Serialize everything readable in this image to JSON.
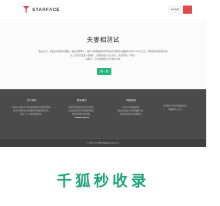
{
  "nav": {
    "brand": "STARFACE",
    "items": [
      {
        "label": "HOME"
      },
      {
        "label": ""
      }
    ],
    "accent": "#e04a4f"
  },
  "hero": {
    "title": "夫妻相测试",
    "desc_lines": [
      "相比之下，夫妻之间有相似表象，通过长期学习。我们从海量面像中研究出来夫妻相似程度评分(SPA100分之6)，帮助您获得来看测试",
      "",
      "请上传您与您爱人的照片，获取来进行对比评分，现在体验一下吧！",
      "结果为：夫妻相指数仅作为娱乐参考"
    ],
    "button": "测一测",
    "button_color": "#25b87e"
  },
  "footer": {
    "columns": [
      {
        "title": "关于我们",
        "lines": [
          "STARFACE基于人脸识别和感知计算技术研发，",
          "拥有丰富多样的智能面部测试模型和功能，",
          "给每个人一种新颖的体验。"
        ],
        "strong": ""
      },
      {
        "title": "联系我们",
        "lines": [
          "您是否有任何建议或合作意向，",
          "欢迎通过邮件与我们取得联系。",
          "我们将尽快为您处理。"
        ],
        "strong": "starface.net.cn"
      },
      {
        "title": "相面测试",
        "lines": [
          "STARFACE相面测试，",
          "通过您的照片来进行面相分析，",
          "为您解读命运与性格特征。"
        ],
        "strong": ""
      },
      {
        "title": "",
        "lines": [
          "我们致力于打造有趣的测试，",
          "把趣味带入生活。"
        ],
        "strong": ""
      }
    ],
    "copyright_prefix": "© 2019-2020 ",
    "copyright_link": "http://starface.net.cn",
    "copyright_suffix": "  Inc."
  },
  "watermark": "千狐秒收录"
}
